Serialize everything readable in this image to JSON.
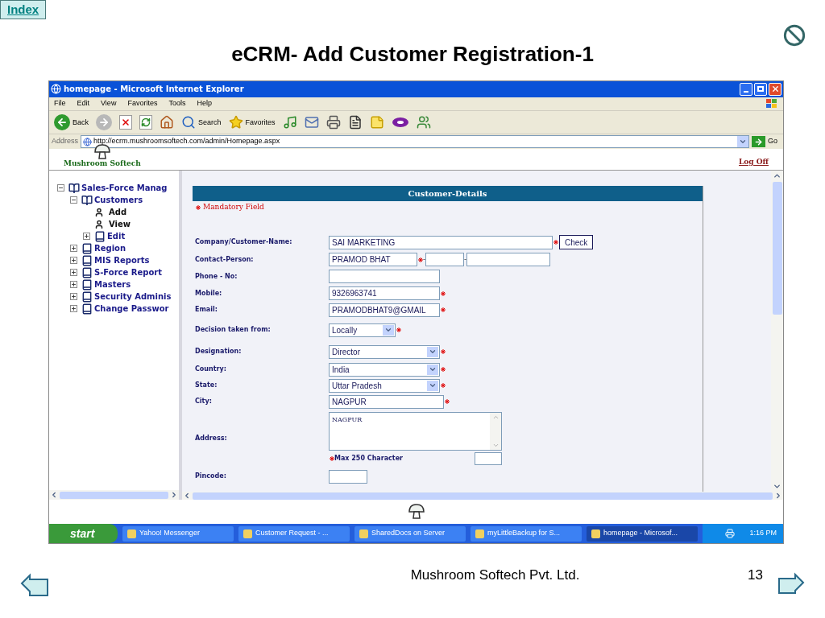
{
  "slide": {
    "index_button": "Index",
    "title": "eCRM- Add Customer Registration-1",
    "footer": "Mushroom Softech Pvt. Ltd.",
    "page_number": "13"
  },
  "browser": {
    "title": "homepage - Microsoft Internet Explorer",
    "menu": [
      "File",
      "Edit",
      "View",
      "Favorites",
      "Tools",
      "Help"
    ],
    "toolbar": [
      {
        "kind": "back",
        "label": "Back"
      },
      {
        "kind": "forward"
      },
      {
        "kind": "stop"
      },
      {
        "kind": "refresh"
      },
      {
        "kind": "home"
      },
      {
        "kind": "search",
        "label": "Search"
      },
      {
        "kind": "favorites",
        "label": "Favorites"
      },
      {
        "kind": "media"
      },
      {
        "kind": "mail"
      },
      {
        "kind": "print"
      },
      {
        "kind": "edit"
      },
      {
        "kind": "note"
      },
      {
        "kind": "yahoo"
      },
      {
        "kind": "messenger"
      }
    ],
    "address_label": "Address",
    "url": "http://ecrm.mushroomsoftech.com/admin/Homepage.aspx",
    "go": "Go"
  },
  "page": {
    "brand": "Mushroom Softech",
    "logoff": "Log Off",
    "tree": [
      {
        "label": "Sales-Force Manag",
        "kind": "folder",
        "expanded": true,
        "children": [
          {
            "label": "Customers",
            "kind": "folder",
            "expanded": true,
            "children": [
              {
                "label": "Add",
                "kind": "page"
              },
              {
                "label": "View",
                "kind": "page"
              },
              {
                "label": "Edit",
                "kind": "folder",
                "expanded": false
              }
            ]
          },
          {
            "label": "Region",
            "kind": "folder",
            "expanded": false
          },
          {
            "label": "MIS Reports",
            "kind": "folder",
            "expanded": false
          },
          {
            "label": "S-Force Report",
            "kind": "folder",
            "expanded": false
          },
          {
            "label": "Masters",
            "kind": "folder",
            "expanded": false
          },
          {
            "label": "Security Adminis",
            "kind": "folder",
            "expanded": false
          },
          {
            "label": "Change Passwor",
            "kind": "folder",
            "expanded": false
          }
        ]
      }
    ],
    "form": {
      "title": "Customer-Details",
      "legend": "Mandatory Field",
      "rows": [
        {
          "kind": "text",
          "label": "Company/Customer-Name:",
          "value": "SAI MARKETING",
          "required": true,
          "button": "Check"
        },
        {
          "kind": "contact",
          "label": "Contact-Person:",
          "value": "PRAMOD BHAT",
          "required": true,
          "separators": [
            "-",
            "-"
          ]
        },
        {
          "kind": "text",
          "label": "Phone - No:",
          "required": false
        },
        {
          "kind": "text",
          "label": "Mobile:",
          "value": "9326963741",
          "required": true
        },
        {
          "kind": "text",
          "label": "Email:",
          "value": "PRAMODBHAT9@GMAIL",
          "required": true
        },
        {
          "kind": "select",
          "label": "Decision taken from:",
          "value": "Locally",
          "required": true
        },
        {
          "kind": "select",
          "label": "Designation:",
          "value": "Director",
          "required": true
        },
        {
          "kind": "select",
          "label": "Country:",
          "value": "India",
          "required": true
        },
        {
          "kind": "select",
          "label": "State:",
          "value": "Uttar Pradesh",
          "required": true
        },
        {
          "kind": "text",
          "label": "City:",
          "value": "NAGPUR",
          "required": true
        },
        {
          "kind": "textarea",
          "label": "Address:",
          "value": "NAGPUR",
          "required": false,
          "note": "Max 250 Character"
        },
        {
          "kind": "text",
          "label": "Pincode:",
          "required": false
        }
      ]
    }
  },
  "taskbar": {
    "start": "start",
    "items": [
      {
        "label": "Yahoo! Messenger",
        "selected": false
      },
      {
        "label": "Customer Request - ...",
        "selected": false
      },
      {
        "label": "SharedDocs on Server",
        "selected": false
      },
      {
        "label": "myLittleBackup for S...",
        "selected": false
      },
      {
        "label": "homepage - Microsof...",
        "selected": true
      }
    ],
    "clock": "1:16 PM"
  }
}
